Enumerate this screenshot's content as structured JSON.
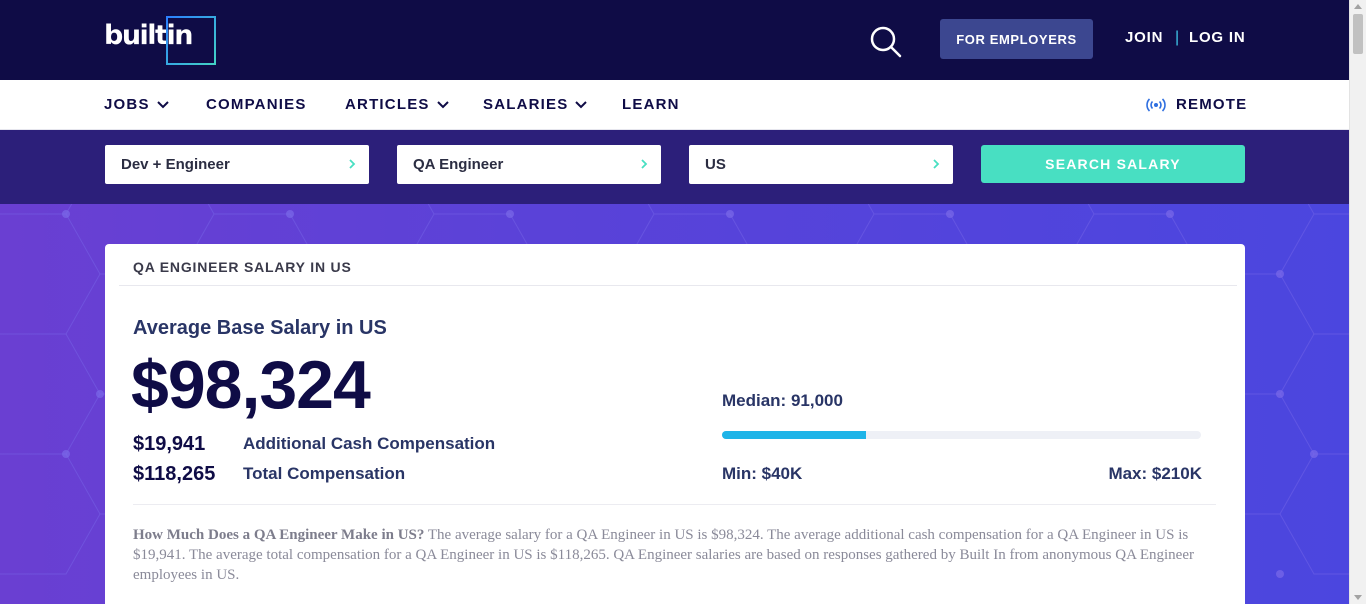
{
  "header": {
    "logo_text": "builtin",
    "employers_label": "FOR EMPLOYERS",
    "join_label": "JOIN",
    "separator": "|",
    "login_label": "LOG IN",
    "search_icon": "search-icon"
  },
  "nav": {
    "items": [
      {
        "label": "JOBS",
        "has_dropdown": true
      },
      {
        "label": "COMPANIES",
        "has_dropdown": false
      },
      {
        "label": "ARTICLES",
        "has_dropdown": true
      },
      {
        "label": "SALARIES",
        "has_dropdown": true
      },
      {
        "label": "LEARN",
        "has_dropdown": false
      }
    ],
    "remote_label": "REMOTE",
    "remote_icon": "broadcast-icon"
  },
  "search": {
    "category_value": "Dev + Engineer",
    "role_value": "QA Engineer",
    "location_value": "US",
    "button_label": "SEARCH SALARY"
  },
  "card": {
    "heading": "QA ENGINEER SALARY IN US",
    "avg_title": "Average Base Salary in US",
    "avg_salary": "$98,324",
    "additional_value": "$19,941",
    "additional_label": "Additional Cash Compensation",
    "total_value": "$118,265",
    "total_label": "Total Compensation",
    "median_label": "Median: 91,000",
    "min_label": "Min: $40K",
    "max_label": "Max: $210K",
    "median_fraction": 0.3,
    "desc_bold": "How Much Does a QA Engineer Make in US?",
    "desc_text": " The average salary for a QA Engineer in US is $98,324. The average additional cash compensation for a QA Engineer in US is $19,941. The average total compensation for a QA Engineer in US is $118,265. QA Engineer salaries are based on responses gathered by Built In from anonymous QA Engineer employees in US."
  },
  "colors": {
    "navy": "#0f0c46",
    "accent_teal": "#48dfc2",
    "bar_blue": "#1eb4e8",
    "employers_btn": "#3c4790",
    "hero_purple": "#5a42d8"
  }
}
